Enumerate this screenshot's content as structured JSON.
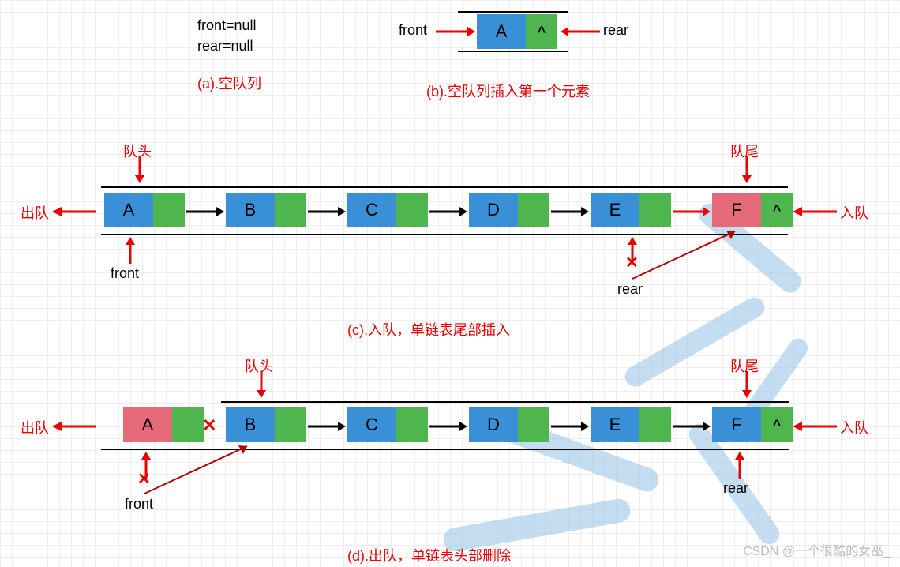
{
  "a": {
    "front": "front=null",
    "rear": "rear=null",
    "caption": "(a).空队列"
  },
  "b": {
    "front_lbl": "front",
    "rear_lbl": "rear",
    "node": "A",
    "term": "^",
    "caption": "(b).空队列插入第一个元素"
  },
  "c": {
    "head_lbl": "队头",
    "tail_lbl": "队尾",
    "dequeue_lbl": "出队",
    "enqueue_lbl": "入队",
    "front_lbl": "front",
    "rear_lbl": "rear",
    "nodes": [
      "A",
      "B",
      "C",
      "D",
      "E",
      "F"
    ],
    "term": "^",
    "x_mark": "✕",
    "caption": "(c).入队，单链表尾部插入"
  },
  "d": {
    "head_lbl": "队头",
    "tail_lbl": "队尾",
    "dequeue_lbl": "出队",
    "enqueue_lbl": "入队",
    "front_lbl": "front",
    "rear_lbl": "rear",
    "nodes": [
      "A",
      "B",
      "C",
      "D",
      "E",
      "F"
    ],
    "term": "^",
    "x_mark1": "✕",
    "x_mark2": "✕",
    "caption": "(d).出队，单链表头部删除"
  },
  "watermark": "CSDN @一个很酷的女巫_",
  "chart_data": {
    "type": "table",
    "description": "Linked-list queue operations",
    "panels": [
      {
        "id": "a",
        "title": "空队列",
        "state": {
          "front": null,
          "rear": null,
          "list": []
        }
      },
      {
        "id": "b",
        "title": "空队列插入第一个元素",
        "state": {
          "front": "A",
          "rear": "A",
          "list": [
            "A"
          ]
        }
      },
      {
        "id": "c",
        "title": "入队，单链表尾部插入",
        "state": {
          "front": "A",
          "rear_before": "E",
          "rear_after": "F",
          "list": [
            "A",
            "B",
            "C",
            "D",
            "E",
            "F"
          ],
          "operation": "enqueue F at tail",
          "dequeue_side": "left",
          "enqueue_side": "right"
        }
      },
      {
        "id": "d",
        "title": "出队，单链表头部删除",
        "state": {
          "front_before": "A",
          "front_after": "B",
          "rear": "F",
          "list_after": [
            "B",
            "C",
            "D",
            "E",
            "F"
          ],
          "removed": "A",
          "operation": "dequeue A from head",
          "dequeue_side": "left",
          "enqueue_side": "right"
        }
      }
    ],
    "colors": {
      "data_cell": "#3a90d6",
      "ptr_cell": "#4fb64f",
      "highlight_cell": "#e66a7a",
      "label": "#e60000"
    }
  }
}
